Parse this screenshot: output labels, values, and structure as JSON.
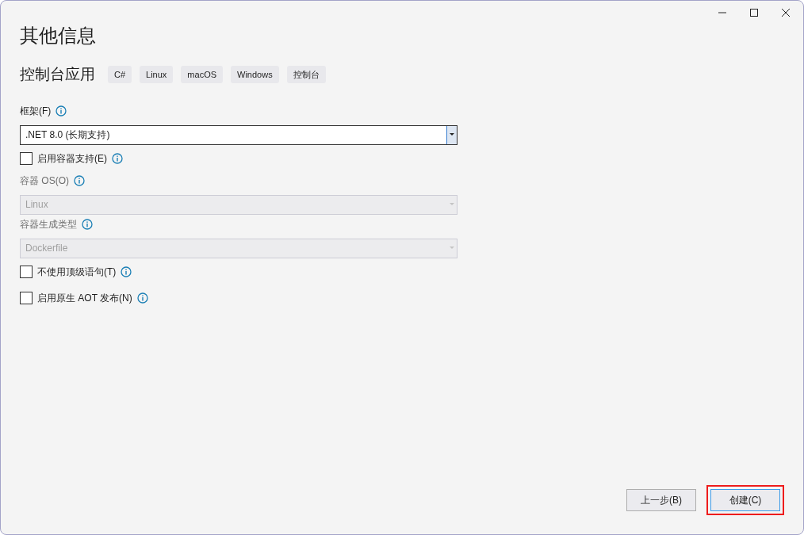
{
  "window": {
    "controls": [
      {
        "kind": "minimize"
      },
      {
        "kind": "maximize"
      },
      {
        "kind": "close"
      }
    ]
  },
  "title": "其他信息",
  "project": {
    "name": "控制台应用",
    "tags": [
      "C#",
      "Linux",
      "macOS",
      "Windows",
      "控制台"
    ]
  },
  "fields": [
    {
      "kind": "select",
      "label": "框架(F)",
      "value": ".NET 8.0 (长期支持)",
      "disabled": false
    },
    {
      "kind": "checkbox",
      "label": "启用容器支持(E)",
      "checked": false
    },
    {
      "kind": "select",
      "label": "容器 OS(O)",
      "value": "Linux",
      "disabled": true
    },
    {
      "kind": "select",
      "label": "容器生成类型",
      "value": "Dockerfile",
      "disabled": true
    },
    {
      "kind": "checkbox",
      "label": "不使用顶级语句(T)",
      "checked": false
    },
    {
      "kind": "checkbox",
      "label": "启用原生 AOT 发布(N)",
      "checked": false
    }
  ],
  "buttons": [
    {
      "label": "上一步(B)",
      "primary": false,
      "highlighted": false
    },
    {
      "label": "创建(C)",
      "primary": true,
      "highlighted": true
    }
  ]
}
